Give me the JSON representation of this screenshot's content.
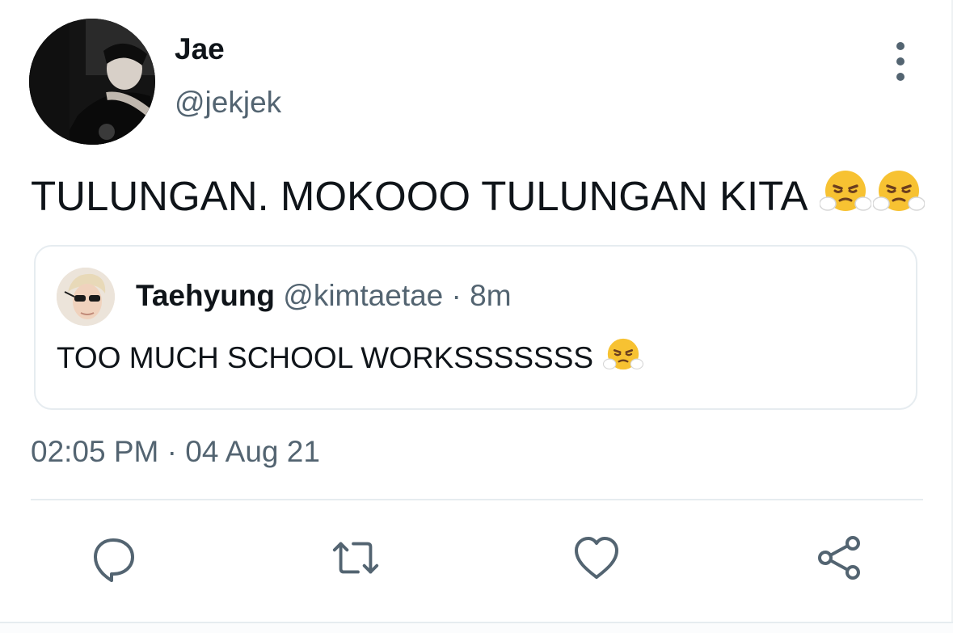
{
  "tweet": {
    "display_name": "Jae",
    "handle": "@jekjek",
    "text": "TULUNGAN. MOKOOO TULUNGAN KITA",
    "text_emojis": [
      "face-with-steam-from-nose-emoji",
      "face-with-steam-from-nose-emoji"
    ],
    "timestamp": "02:05 PM · 04 Aug 21"
  },
  "quoted_tweet": {
    "display_name": "Taehyung",
    "handle": "@kimtaetae",
    "separator": "·",
    "time_ago": "8m",
    "text": "TOO MUCH SCHOOL WORKSSSSSSS",
    "text_emojis": [
      "face-with-steam-from-nose-emoji"
    ]
  },
  "actions": [
    "reply-icon",
    "retweet-icon",
    "like-icon",
    "share-icon"
  ],
  "colors": {
    "primary_text": "#0f1419",
    "secondary_text": "#536471",
    "border": "#e6ecf0",
    "icon": "#536471"
  }
}
